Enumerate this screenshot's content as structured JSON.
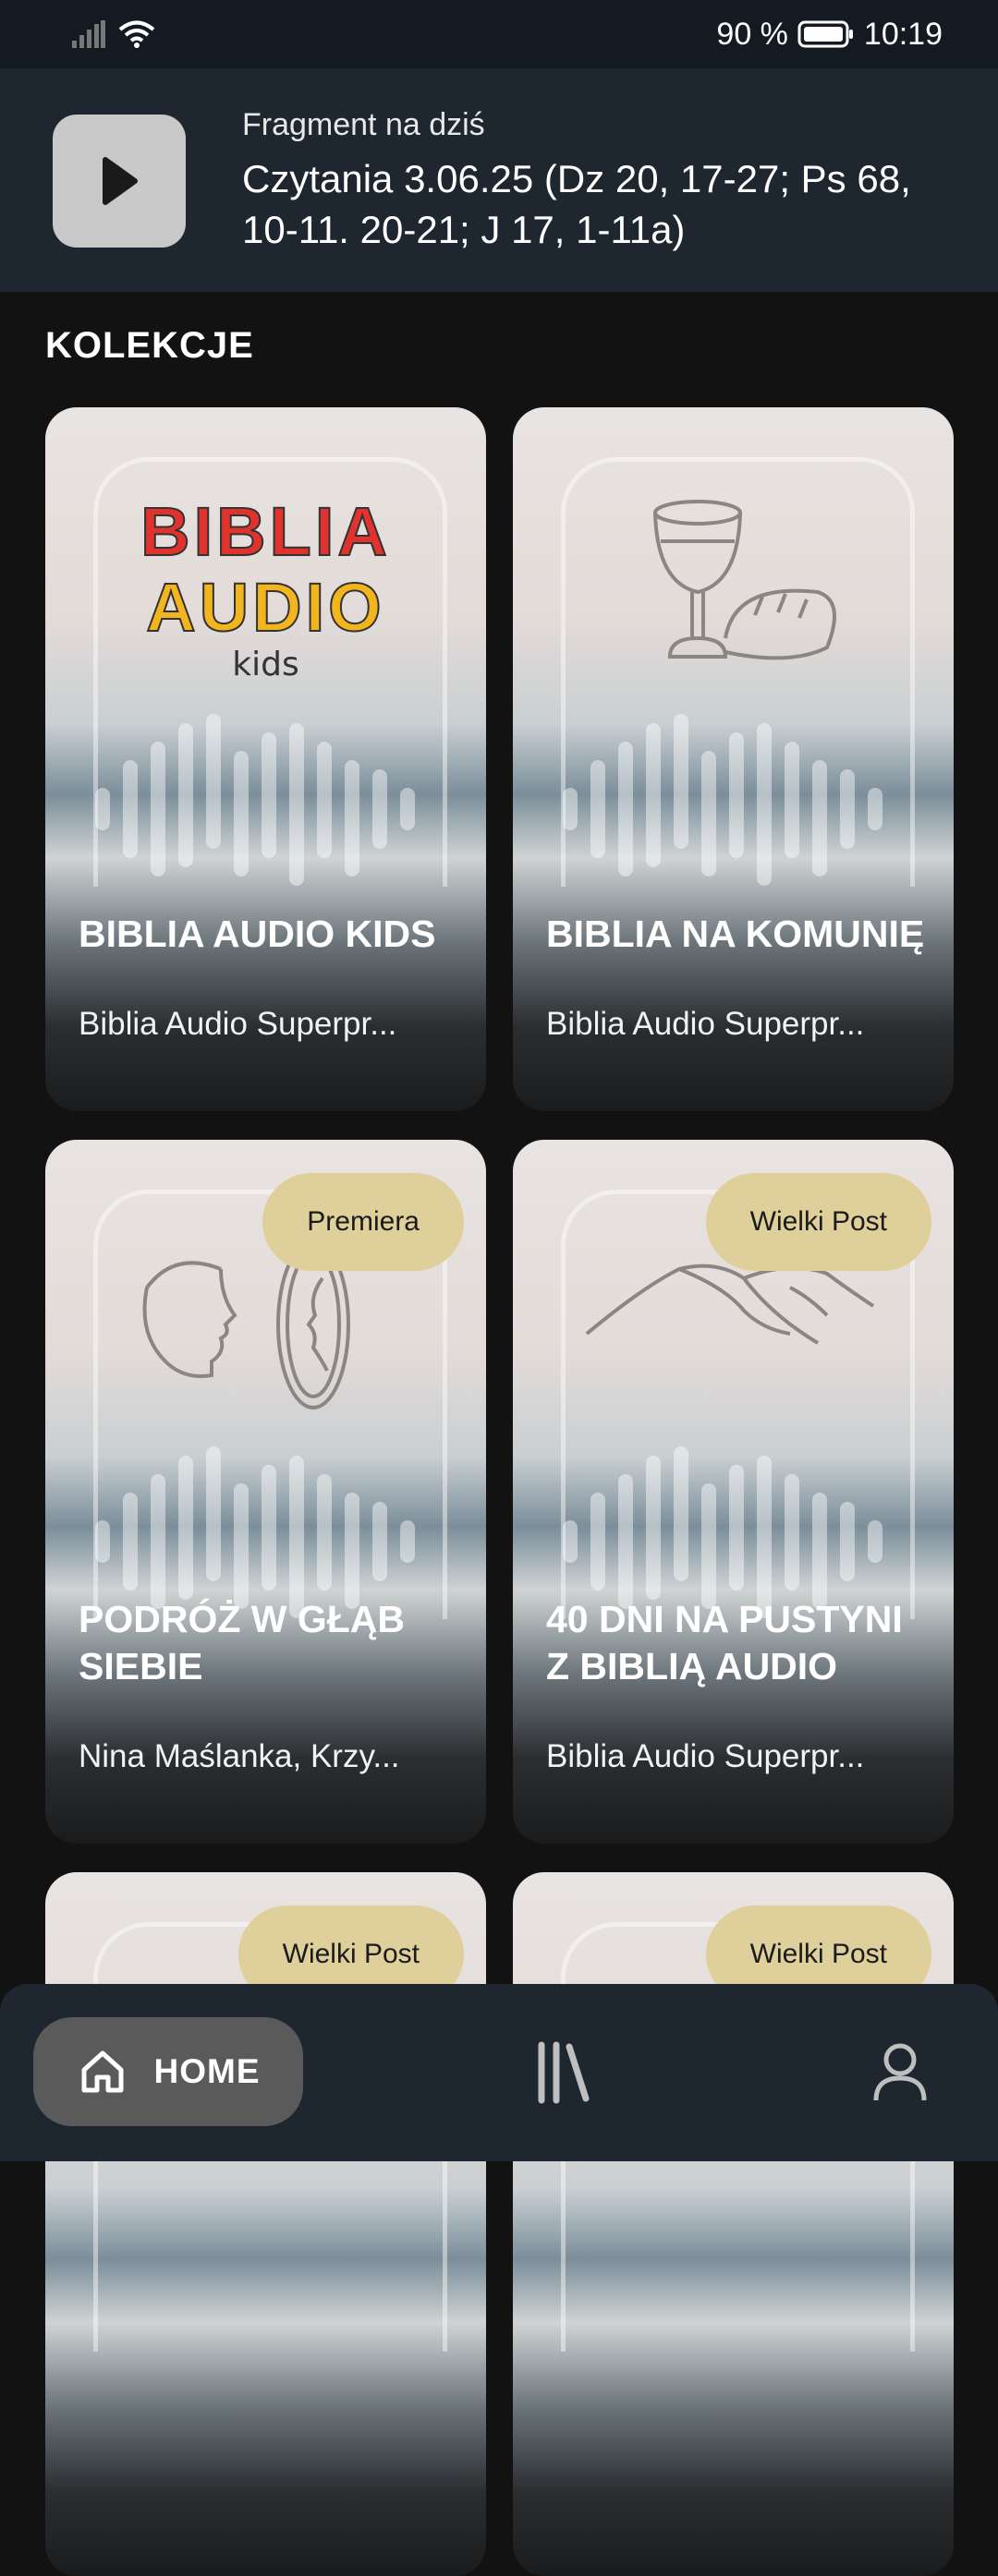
{
  "status_bar": {
    "battery": "90 %",
    "time": "10:19"
  },
  "player": {
    "label": "Fragment na dziś",
    "title": "Czytania 3.06.25 (Dz 20, 17-27; Ps 68, 10-11. 20-21; J 17, 1-11a)"
  },
  "section": {
    "title": "KOLEKCJE"
  },
  "logo": {
    "line1": "BIBLIA",
    "line2": "AUDIO",
    "line3": "kids"
  },
  "cards": [
    {
      "title": "BIBLIA AUDIO KIDS",
      "subtitle": "Biblia Audio Superpr...",
      "badge": "",
      "art": "biblia-audio-kids-logo"
    },
    {
      "title": "BIBLIA NA KOMUNIĘ",
      "subtitle": "Biblia Audio Superpr...",
      "badge": "",
      "art": "chalice-bread-icon"
    },
    {
      "title": "PODRÓŻ W GŁĄB SIEBIE",
      "subtitle": "Nina Maślanka, Krzy...",
      "badge": "Premiera",
      "art": "mirror-face-icon"
    },
    {
      "title": "40 DNI NA PUSTYNI Z BIBLIĄ AUDIO",
      "subtitle": "Biblia Audio Superpr...",
      "badge": "Wielki Post",
      "art": "desert-dunes-icon"
    },
    {
      "title": "",
      "subtitle": "",
      "badge": "Wielki Post",
      "art": ""
    },
    {
      "title": "",
      "subtitle": "",
      "badge": "Wielki Post",
      "art": ""
    }
  ],
  "bottom_nav": {
    "home_label": "HOME"
  },
  "colors": {
    "badge": "#dfcf9a",
    "nav_bg": "#1e2630",
    "player_bg": "#1e2630",
    "home_pill": "#5a5a5a"
  }
}
